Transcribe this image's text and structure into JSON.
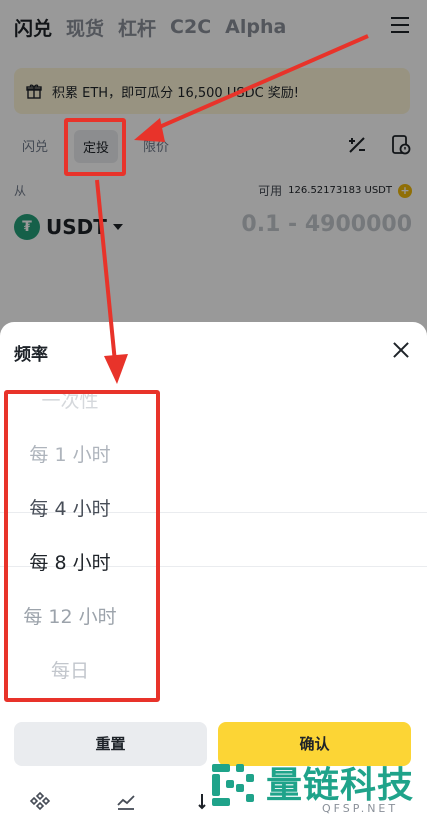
{
  "top_tabs": [
    "闪兑",
    "现货",
    "杠杆",
    "C2C",
    "Alpha"
  ],
  "promo": {
    "text": "积累 ETH，即可瓜分 16,500 USDC 奖励!"
  },
  "sub_tabs": [
    "闪兑",
    "定投",
    "限价"
  ],
  "from": {
    "label": "从",
    "available_label": "可用",
    "available_value": "126.52173183 USDT",
    "coin": "USDT",
    "amount_placeholder": "0.1 - 4900000"
  },
  "sheet": {
    "title": "频率",
    "options": [
      "一次性",
      "每 1 小时",
      "每 4 小时",
      "每 8 小时",
      "每 12 小时",
      "每日"
    ],
    "selected_index": 3,
    "reset_label": "重置",
    "confirm_label": "确认"
  },
  "watermark": {
    "text": "量链科技",
    "sub": "QFSP.NET"
  },
  "icons": {
    "menu": "hamburger-menu-icon",
    "promo": "gift-icon",
    "tool1": "slash-percent-icon",
    "tool2": "order-history-icon",
    "close": "close-icon",
    "nav1": "binance-home-icon",
    "nav2": "markets-chart-icon",
    "nav3": "trade-swap-icon"
  },
  "colors": {
    "brand_yellow": "#fcd535",
    "usdt_green": "#26a17b",
    "annotation_red": "#e8332a",
    "watermark_green": "#1fa38a"
  }
}
